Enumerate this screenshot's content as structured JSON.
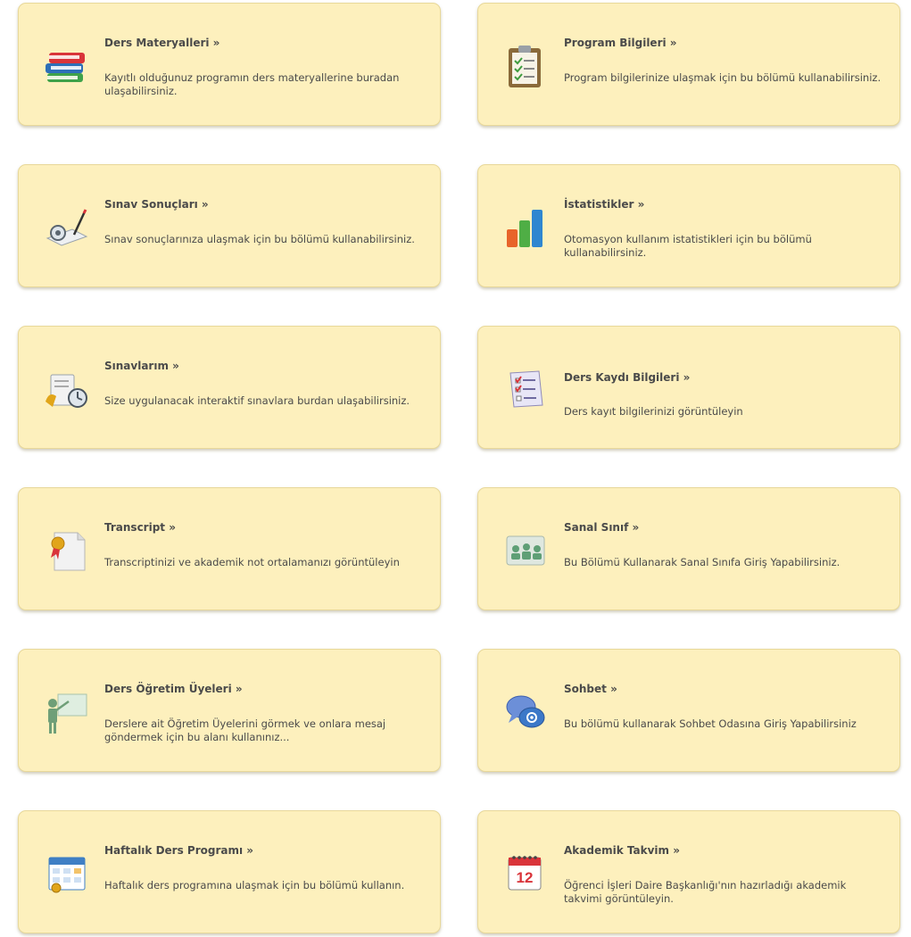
{
  "cards": [
    {
      "title": "Ders Materyalleri »",
      "desc": "Kayıtlı olduğunuz programın ders materyallerine buradan ulaşabilirsiniz.",
      "icon": "books-icon"
    },
    {
      "title": "Program Bilgileri »",
      "desc": "Program bilgilerinize ulaşmak için bu bölümü kullanabilirsiniz.",
      "icon": "clipboard-icon"
    },
    {
      "title": "Sınav Sonuçları »",
      "desc": "Sınav sonuçlarınıza ulaşmak için bu bölümü kullanabilirsiniz.",
      "icon": "exam-results-icon"
    },
    {
      "title": "İstatistikler »",
      "desc": "Otomasyon kullanım istatistikleri için bu bölümü kullanabilirsiniz.",
      "icon": "bar-chart-icon"
    },
    {
      "title": "Sınavlarım »",
      "desc": "Size uygulanacak interaktif sınavlara burdan ulaşabilirsiniz.",
      "icon": "timed-exam-icon"
    },
    {
      "title": "Ders Kaydı Bilgileri »",
      "desc": "Ders kayıt bilgilerinizi görüntüleyin",
      "icon": "checklist-icon"
    },
    {
      "title": "Transcript »",
      "desc": "Transcriptinizi ve akademik not ortalamanızı görüntüleyin",
      "icon": "certificate-icon"
    },
    {
      "title": "Sanal Sınıf »",
      "desc": "Bu Bölümü Kullanarak Sanal Sınıfa Giriş Yapabilirsiniz.",
      "icon": "virtual-class-icon"
    },
    {
      "title": "Ders Öğretim Üyeleri »",
      "desc": "Derslere ait Öğretim Üyelerini görmek ve onlara mesaj göndermek için bu alanı kullanınız...",
      "icon": "teacher-icon"
    },
    {
      "title": "Sohbet »",
      "desc": "Bu bölümü kullanarak Sohbet Odasına Giriş Yapabilirsiniz",
      "icon": "chat-bubbles-icon"
    },
    {
      "title": "Haftalık Ders Programı »",
      "desc": "Haftalık ders programına ulaşmak için bu bölümü kullanın.",
      "icon": "weekly-schedule-icon"
    },
    {
      "title": "Akademik Takvim »",
      "desc": "Öğrenci İşleri Daire Başkanlığı'nın hazırladığı akademik takvimi görüntüleyin.",
      "icon": "calendar-icon",
      "calendar_day": "12"
    }
  ],
  "colors": {
    "card_bg": "#fdf0bd",
    "card_border": "#e8d89a",
    "text": "#4a4a4a"
  }
}
